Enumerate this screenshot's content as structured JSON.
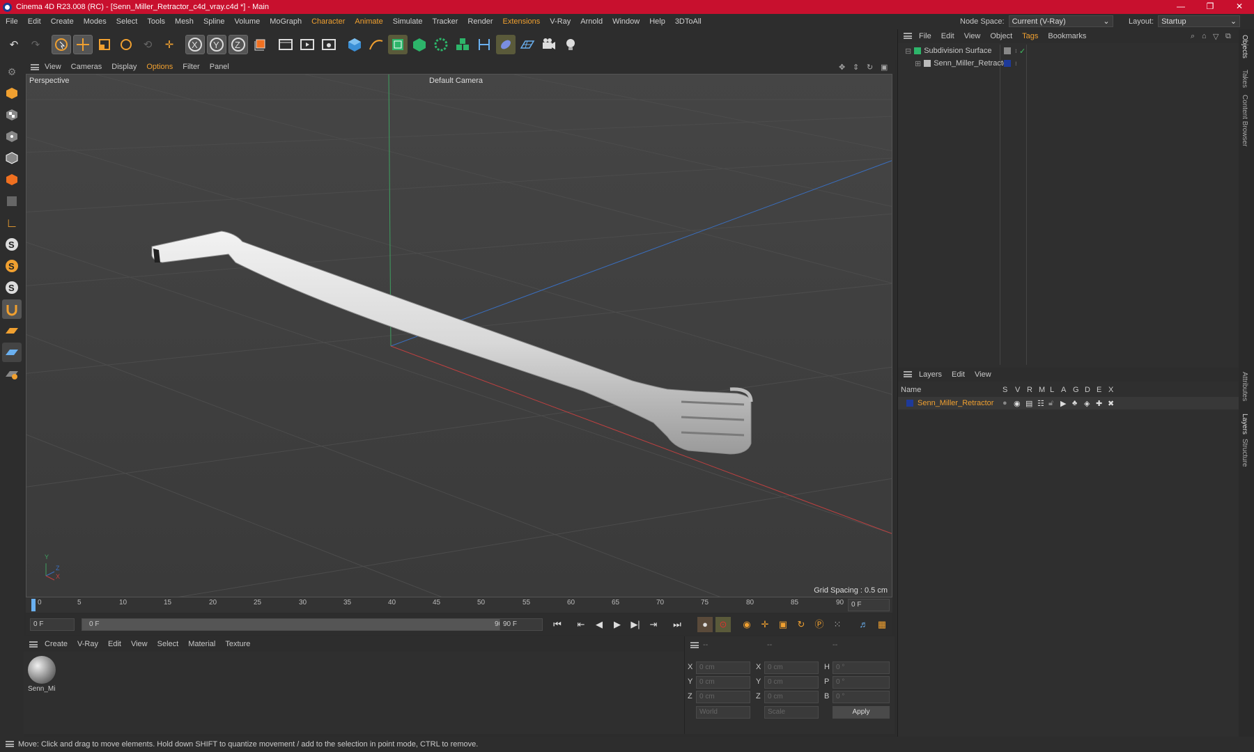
{
  "app": {
    "title": "Cinema 4D R23.008 (RC) - [Senn_Miller_Retractor_c4d_vray.c4d *] - Main",
    "window_controls": [
      "—",
      "❐",
      "✕"
    ]
  },
  "menubar": {
    "items": [
      "File",
      "Edit",
      "Create",
      "Modes",
      "Select",
      "Tools",
      "Mesh",
      "Spline",
      "Volume",
      "MoGraph",
      "Character",
      "Animate",
      "Simulate",
      "Tracker",
      "Render",
      "Extensions",
      "V-Ray",
      "Arnold",
      "Window",
      "Help",
      "3DToAll"
    ],
    "node_space_label": "Node Space:",
    "node_space_value": "Current (V-Ray)",
    "layout_label": "Layout:",
    "layout_value": "Startup"
  },
  "viewport": {
    "menu": [
      "View",
      "Cameras",
      "Display",
      "Options",
      "Filter",
      "Panel"
    ],
    "label": "Perspective",
    "camera": "Default Camera",
    "grid_spacing": "Grid Spacing : 0.5 cm",
    "axis_labels": [
      "Y",
      "Z",
      "X"
    ]
  },
  "timeline": {
    "ticks": [
      "0",
      "5",
      "10",
      "15",
      "20",
      "25",
      "30",
      "35",
      "40",
      "45",
      "50",
      "55",
      "60",
      "65",
      "70",
      "75",
      "80",
      "85",
      "90"
    ],
    "current_frame": "0 F",
    "start_frame": "0 F",
    "range_start": "0 F",
    "range_end": "90 F",
    "end_frame": "90 F"
  },
  "material_panel": {
    "menu": [
      "Create",
      "V-Ray",
      "Edit",
      "View",
      "Select",
      "Material",
      "Texture"
    ],
    "material_name": "Senn_Mi"
  },
  "coordinates": {
    "header": [
      "--",
      "--",
      "--"
    ],
    "rows": [
      {
        "a": "X",
        "av": "0 cm",
        "b": "X",
        "bv": "0 cm",
        "c": "H",
        "cv": "0 °"
      },
      {
        "a": "Y",
        "av": "0 cm",
        "b": "Y",
        "bv": "0 cm",
        "c": "P",
        "cv": "0 °"
      },
      {
        "a": "Z",
        "av": "0 cm",
        "b": "Z",
        "bv": "0 cm",
        "c": "B",
        "cv": "0 °"
      }
    ],
    "mode1": "World",
    "mode2": "Scale",
    "apply": "Apply"
  },
  "objects_panel": {
    "menu": [
      "File",
      "Edit",
      "View",
      "Object",
      "Tags",
      "Bookmarks"
    ],
    "items": [
      {
        "name": "Subdivision Surface"
      },
      {
        "name": "Senn_Miller_Retractor"
      }
    ]
  },
  "layers_panel": {
    "menu": [
      "Layers",
      "Edit",
      "View"
    ],
    "col_name": "Name",
    "cols": [
      "S",
      "V",
      "R",
      "M",
      "L",
      "A",
      "G",
      "D",
      "E",
      "X"
    ],
    "layer_name": "Senn_Miller_Retractor"
  },
  "side_tabs": [
    "Objects",
    "Takes",
    "Content Browser",
    "Attributes",
    "Layers",
    "Structure"
  ],
  "status": "Move: Click and drag to move elements. Hold down SHIFT to quantize movement / add to the selection in point mode, CTRL to remove.",
  "colors": {
    "title_bar": "#c8102e",
    "accent": "#f0a030",
    "layer_color": "#1e3a9a"
  }
}
